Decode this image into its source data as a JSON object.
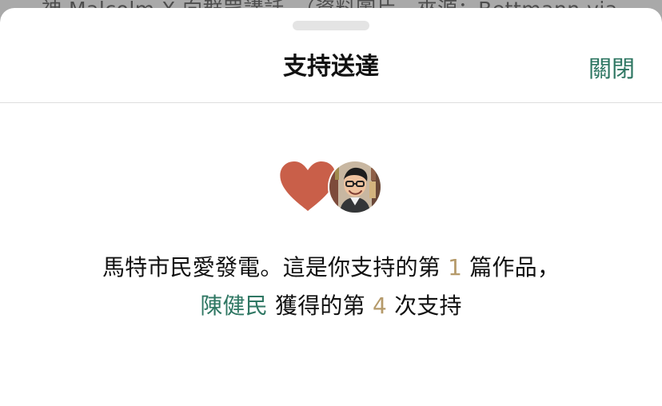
{
  "background": {
    "partial_text": "神 Malcolm X 向群眾講話。（資料圖片，來源：Bettmann via"
  },
  "sheet": {
    "title": "支持送達",
    "close_label": "關閉"
  },
  "icons": {
    "heart": "heart-icon",
    "avatar": "author-avatar"
  },
  "message": {
    "line1_prefix": "馬特市民愛發電。這是你支持的第",
    "line1_number": "1",
    "line1_suffix": "篇作品，",
    "author_name": "陳健民",
    "line2_middle": "獲得的第",
    "line2_number": "4",
    "line2_suffix": "次支持"
  },
  "colors": {
    "accent_green": "#2f7763",
    "accent_gold": "#b59a6a",
    "heart": "#c95f49"
  }
}
